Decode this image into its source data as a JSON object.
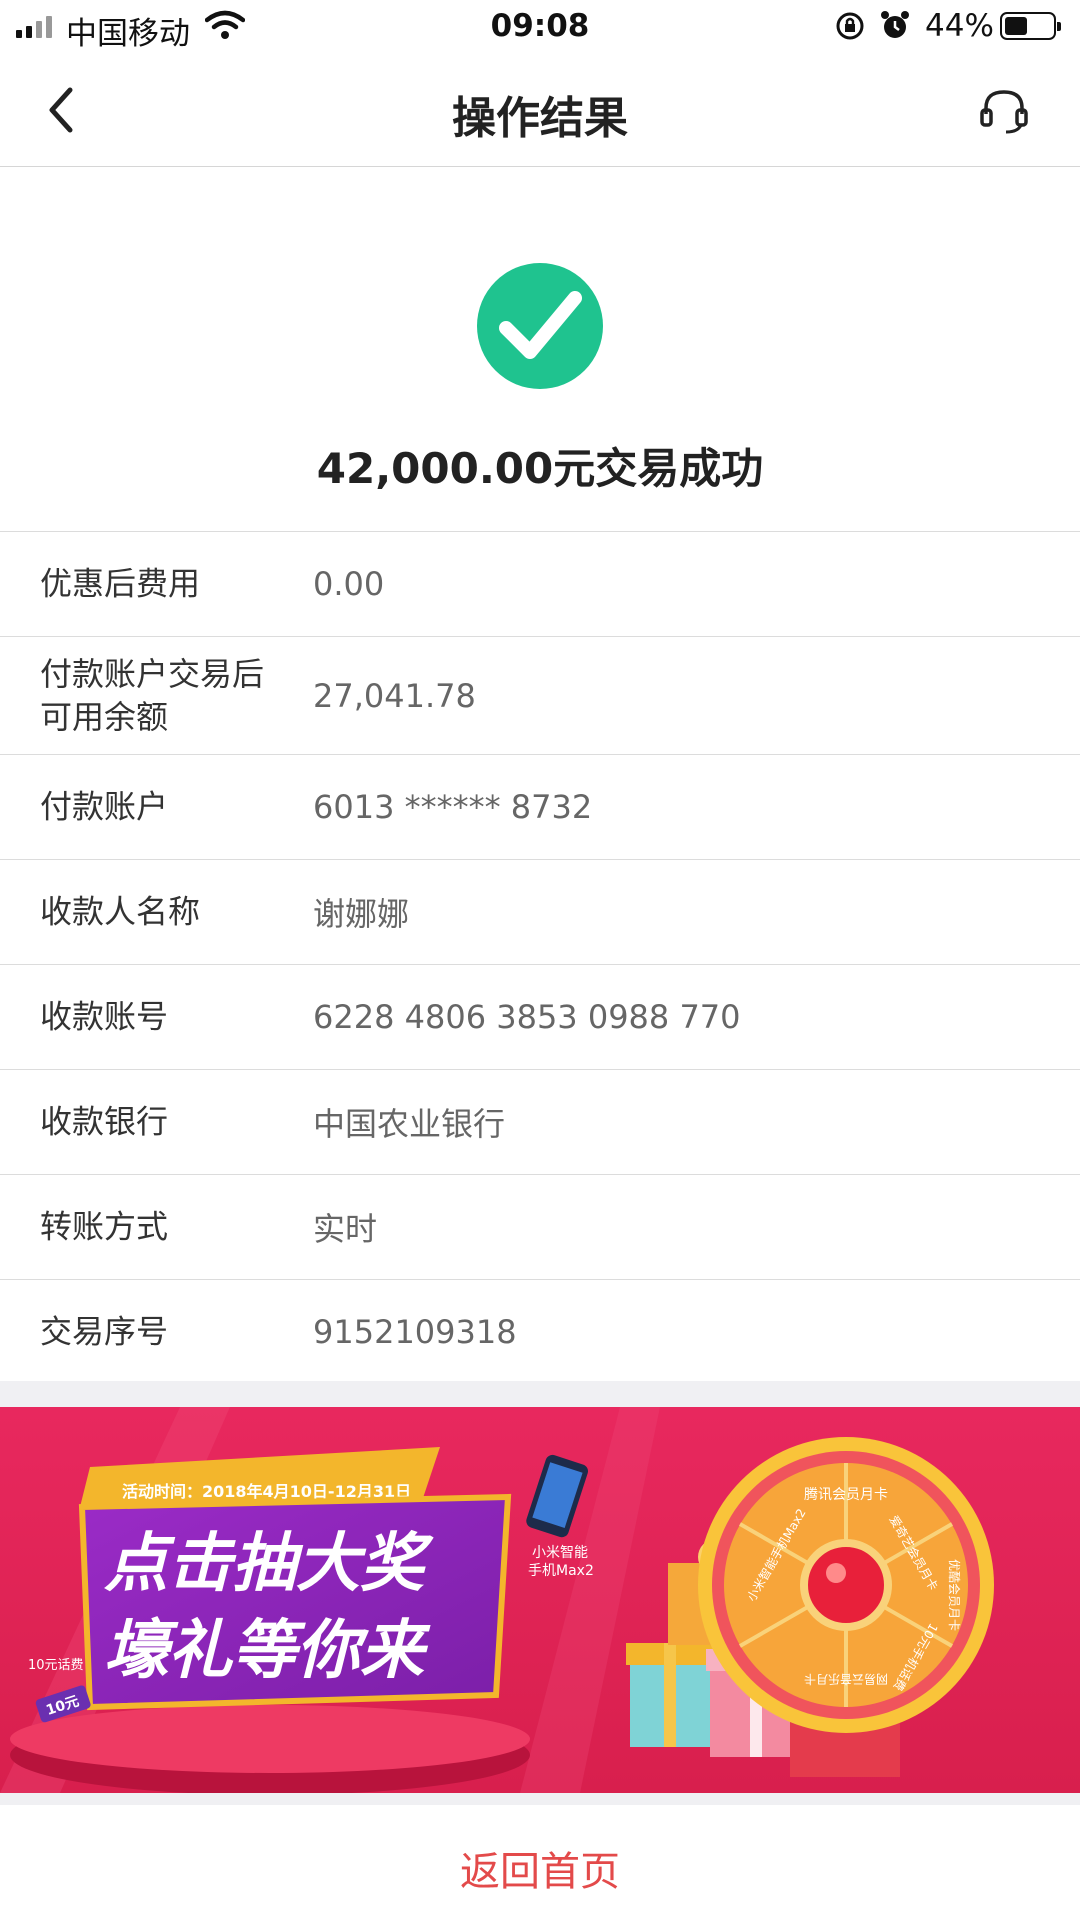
{
  "status_bar": {
    "carrier": "中国移动",
    "time": "09:08",
    "battery_percent": "44%",
    "battery_level": 0.44
  },
  "navbar": {
    "title": "操作结果"
  },
  "result": {
    "message": "42,000.00元交易成功",
    "status_color": "#1fc38f"
  },
  "details": [
    {
      "label": "优惠后费用",
      "value": "0.00"
    },
    {
      "label": "付款账户交易后可用余额",
      "value": "27,041.78"
    },
    {
      "label": "付款账户",
      "value": "6013 ****** 8732"
    },
    {
      "label": "收款人名称",
      "value": "谢娜娜"
    },
    {
      "label": "收款账号",
      "value": "6228 4806 3853 0988 770"
    },
    {
      "label": "收款银行",
      "value": "中国农业银行"
    },
    {
      "label": "转账方式",
      "value": "实时"
    },
    {
      "label": "交易序号",
      "value": "9152109318"
    }
  ],
  "banner": {
    "activity_time": "活动时间：2018年4月10日-12月31日",
    "headline_1": "点击抽大奖",
    "headline_2": "壕礼等你来",
    "phone_label_1": "小米智能",
    "phone_label_2": "手机Max2",
    "phone_credit_label": "10元话费",
    "coupon_label": "10元",
    "wheel_labels": [
      "腾讯会员月卡",
      "爱奇艺会员月卡",
      "优酷会员月卡",
      "10元手机话费",
      "网易云音乐月卡",
      "小米智能手机Max2"
    ]
  },
  "footer": {
    "home_button": "返回首页",
    "accent_color": "#e34a4a"
  }
}
